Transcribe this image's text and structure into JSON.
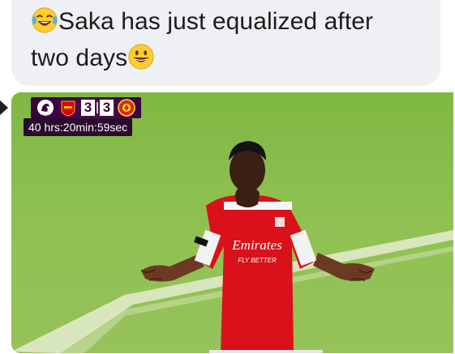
{
  "post": {
    "line1_text": "Saka has just equalized after",
    "line2_text": "two days",
    "lead_emoji": "face-with-tears-of-joy-icon",
    "trail_emoji": "grinning-face-icon"
  },
  "video": {
    "scoreboard": {
      "home_team_crest": "arsenal-crest-icon",
      "home_score": "3",
      "away_score": "3",
      "away_team_crest": "manchester-united-crest-icon",
      "league_logo": "premier-league-logo",
      "league_logo_text": "Premier League"
    },
    "timer_text": "40 hrs:20min:59sec",
    "shirt_sponsor_line1": "Emirates",
    "shirt_sponsor_line2": "FLY BETTER"
  },
  "colors": {
    "bubble_bg": "#eef0f3",
    "text": "#1c1c1c",
    "pl_purple": "#38003c",
    "pitch_green": "#8bbf4f",
    "arsenal_red": "#db0007"
  }
}
